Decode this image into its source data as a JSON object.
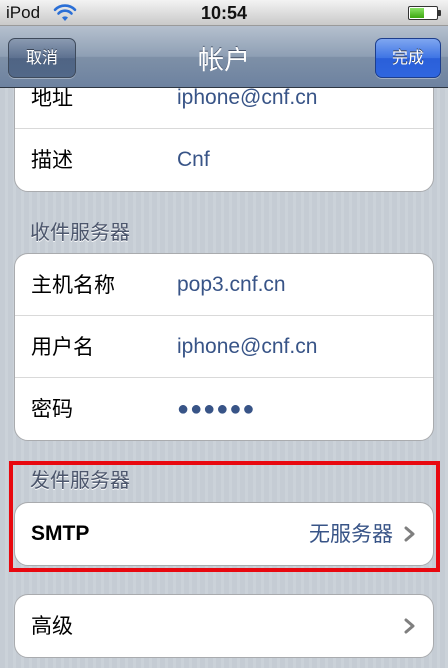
{
  "status_bar": {
    "carrier": "iPod",
    "time": "10:54",
    "battery_level": 0.55
  },
  "nav": {
    "title": "帐户",
    "cancel_label": "取消",
    "done_label": "完成"
  },
  "account_group": {
    "rows": [
      {
        "label": "地址",
        "value": "iphone@cnf.cn"
      },
      {
        "label": "描述",
        "value": "Cnf"
      }
    ]
  },
  "incoming": {
    "header": "收件服务器",
    "rows": [
      {
        "label": "主机名称",
        "value": "pop3.cnf.cn"
      },
      {
        "label": "用户名",
        "value": "iphone@cnf.cn"
      },
      {
        "label": "密码",
        "value": "●●●●●●"
      }
    ]
  },
  "outgoing": {
    "header": "发件服务器",
    "smtp_label": "SMTP",
    "smtp_value": "无服务器"
  },
  "advanced": {
    "label": "高级"
  },
  "colors": {
    "highlight": "#e8080f",
    "value_text": "#385487",
    "done_button": "#2f66df"
  }
}
